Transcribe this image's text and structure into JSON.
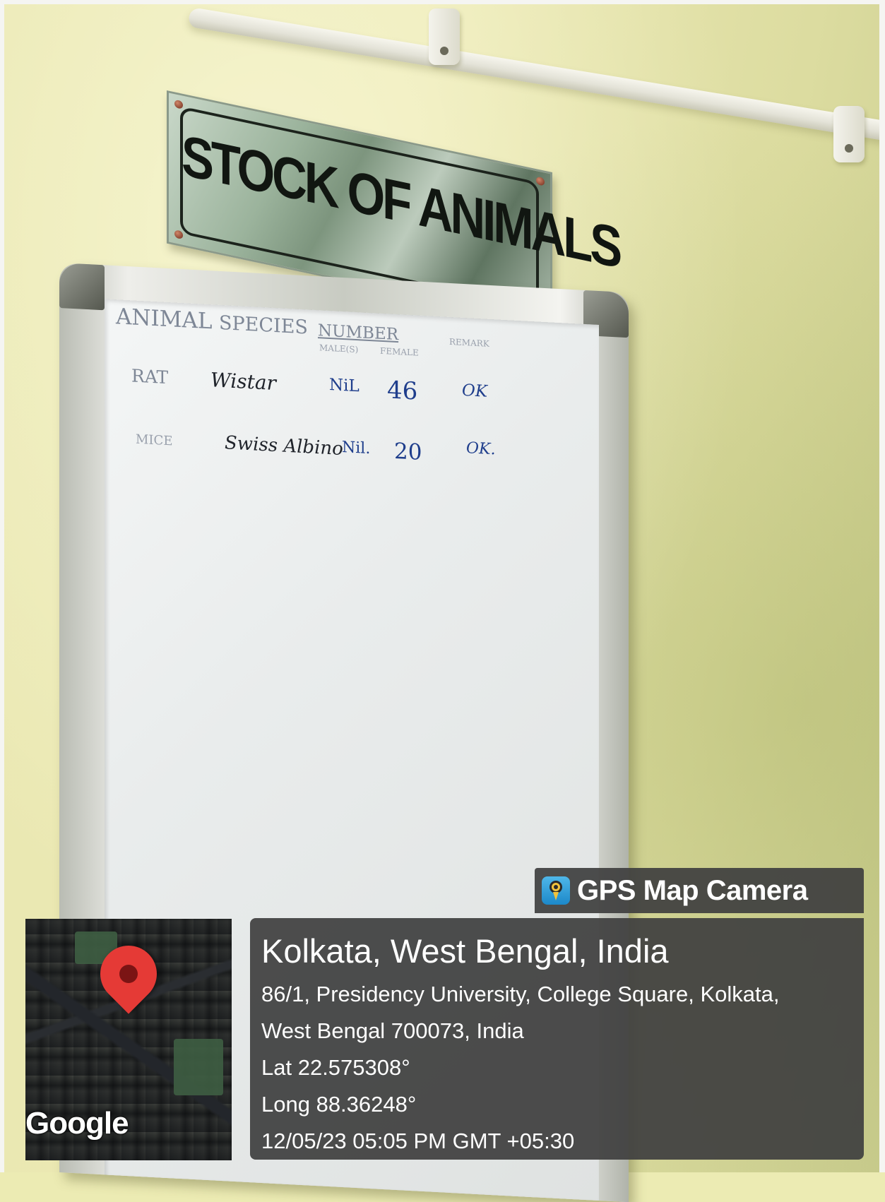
{
  "sign": {
    "text": "STOCK OF ANIMALS"
  },
  "whiteboard": {
    "headers": {
      "animal": "ANIMAL",
      "species": "SPECIES",
      "number": "NUMBER",
      "male": "MALE(S)",
      "female": "FEMALE",
      "remark": "REMARK"
    },
    "rows": [
      {
        "animal": "RAT",
        "species": "Wistar",
        "male": "NiL",
        "female": "46",
        "remark": "OK"
      },
      {
        "animal": "MICE",
        "species": "Swiss Albino",
        "male": "Nil.",
        "female": "20",
        "remark": "OK."
      }
    ]
  },
  "gps_overlay": {
    "app_name": "GPS Map Camera",
    "app_icon": "gps-map-camera-icon",
    "location_title": "Kolkata, West Bengal, India",
    "address_line_1": "86/1, Presidency University, College Square, Kolkata,",
    "address_line_2": "West Bengal 700073, India",
    "latitude": "Lat 22.575308°",
    "longitude": "Long 88.36248°",
    "datetime": "12/05/23 05:05 PM GMT +05:30",
    "map_provider": "Google",
    "pin_color": "#e53a36",
    "panel_color": "#404040"
  }
}
